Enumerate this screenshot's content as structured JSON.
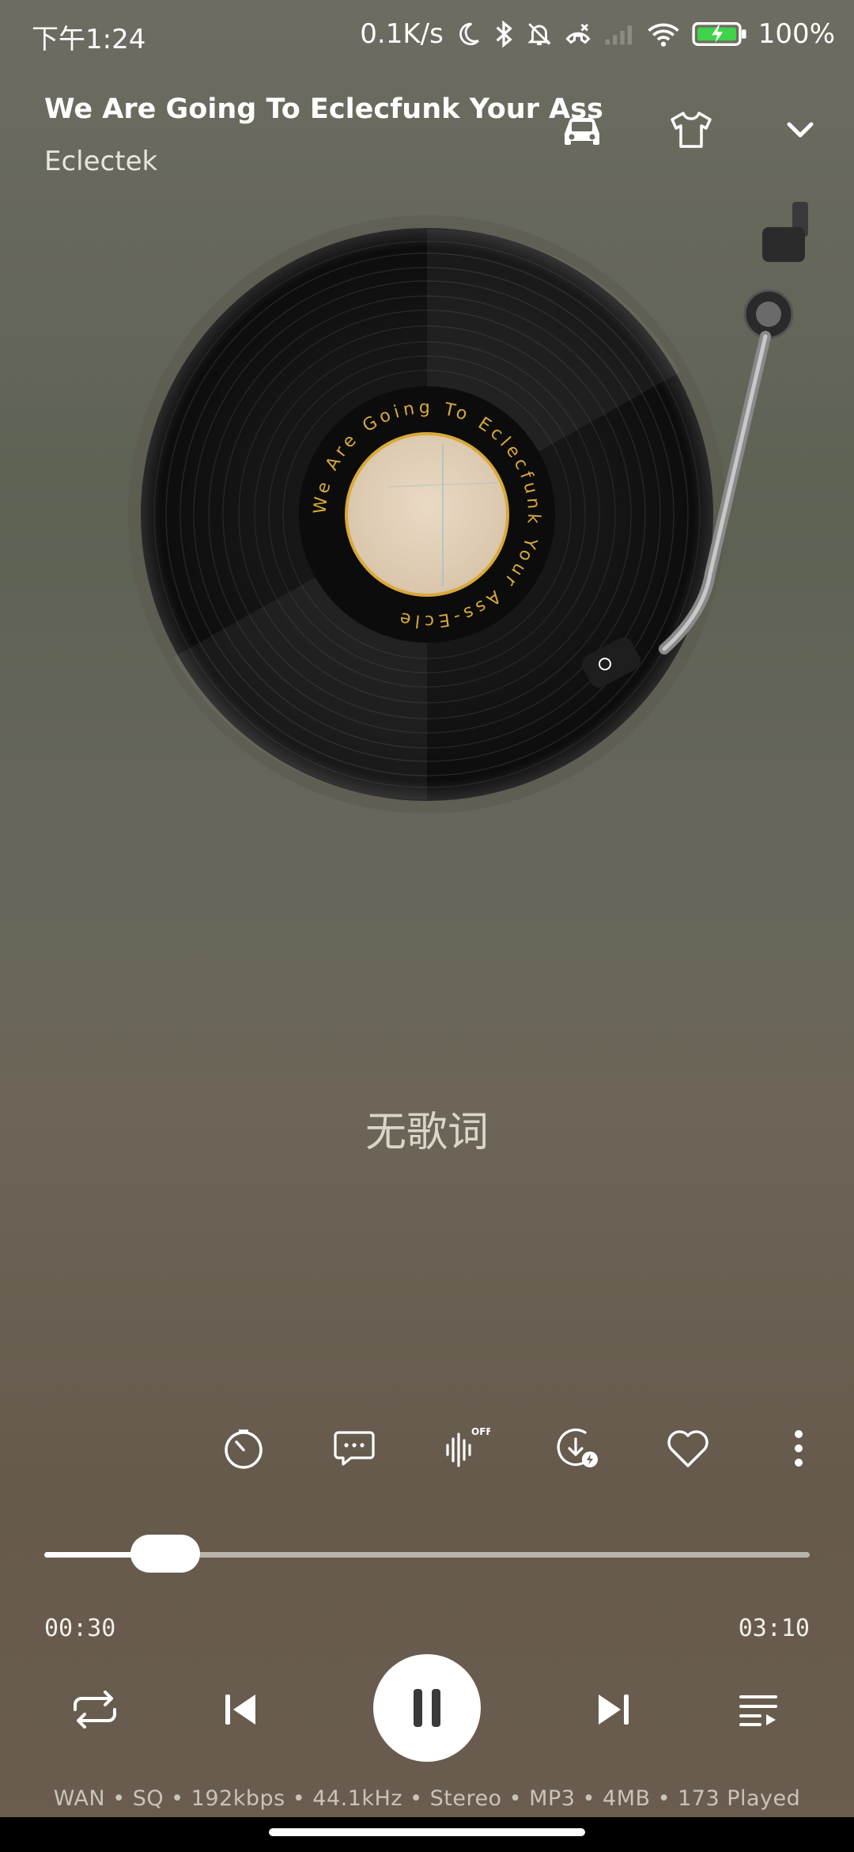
{
  "status_bar": {
    "time": "下午1:24",
    "net_speed": "0.1K/s",
    "battery": "100%",
    "icons": [
      "moon-icon",
      "bluetooth-icon",
      "bell-off-icon",
      "call-icon",
      "signal-icon",
      "wifi-icon",
      "battery-charging-icon"
    ]
  },
  "header": {
    "title": "We Are Going To Eclecfunk Your Ass",
    "artist": "Eclectek",
    "buttons": [
      "car-mode-icon",
      "tshirt-skin-icon",
      "chevron-down-icon"
    ]
  },
  "record": {
    "label_text": "We Are Going To Eclecfunk Your Ass-Ecle",
    "label_color": "#d9a93a"
  },
  "lyrics": {
    "empty_text": "无歌词"
  },
  "actions": {
    "effect_badge": "OFF",
    "icons": [
      "sleep-timer-icon",
      "comment-icon",
      "audio-effect-icon",
      "download-icon",
      "heart-icon",
      "more-icon"
    ]
  },
  "progress": {
    "current": "00:30",
    "total": "03:10",
    "fraction": 0.158
  },
  "controls": [
    "repeat-icon",
    "previous-icon",
    "pause-icon",
    "next-icon",
    "playlist-icon"
  ],
  "info_line": "WAN • SQ • 192kbps • 44.1kHz • Stereo • MP3 • 4MB • 173 Played",
  "colors": {
    "accent": "#ffffff",
    "progress_track": "#b9b4aa"
  }
}
